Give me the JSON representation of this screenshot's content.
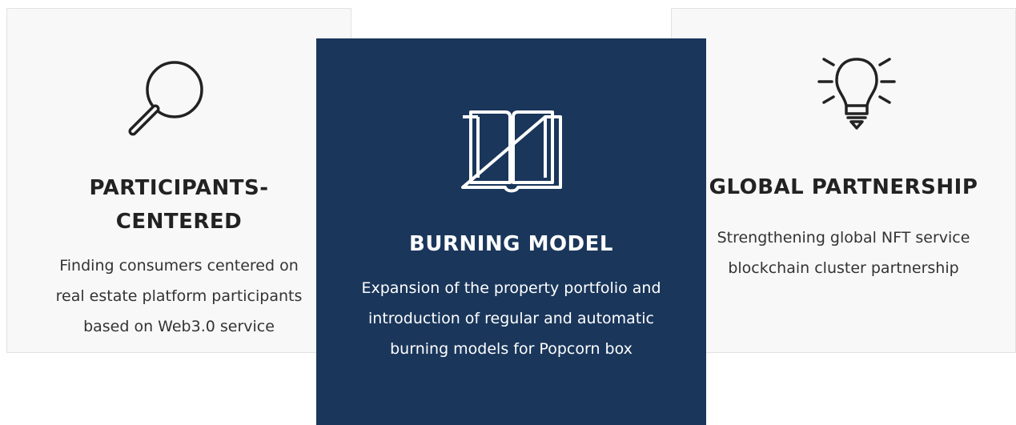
{
  "cards": [
    {
      "title_lines": [
        "PARTICIPANTS-",
        "CENTERED"
      ],
      "desc_lines": [
        "Finding consumers centered on",
        "real estate platform participants",
        "based on Web3.0 service"
      ],
      "icon": "magnifier-icon"
    },
    {
      "title_lines": [
        "BURNING MODEL"
      ],
      "desc_lines": [
        "Expansion of the property portfolio and",
        "introduction of regular and automatic",
        "burning models for Popcorn box"
      ],
      "icon": "open-book-icon"
    },
    {
      "title_lines": [
        "GLOBAL PARTNERSHIP"
      ],
      "desc_lines": [
        "Strengthening global NFT service",
        "blockchain cluster partnership"
      ],
      "icon": "lightbulb-icon"
    }
  ],
  "colors": {
    "dark_card": "#1a365b",
    "light_card": "#f8f8f8",
    "text_dark": "#222222"
  }
}
